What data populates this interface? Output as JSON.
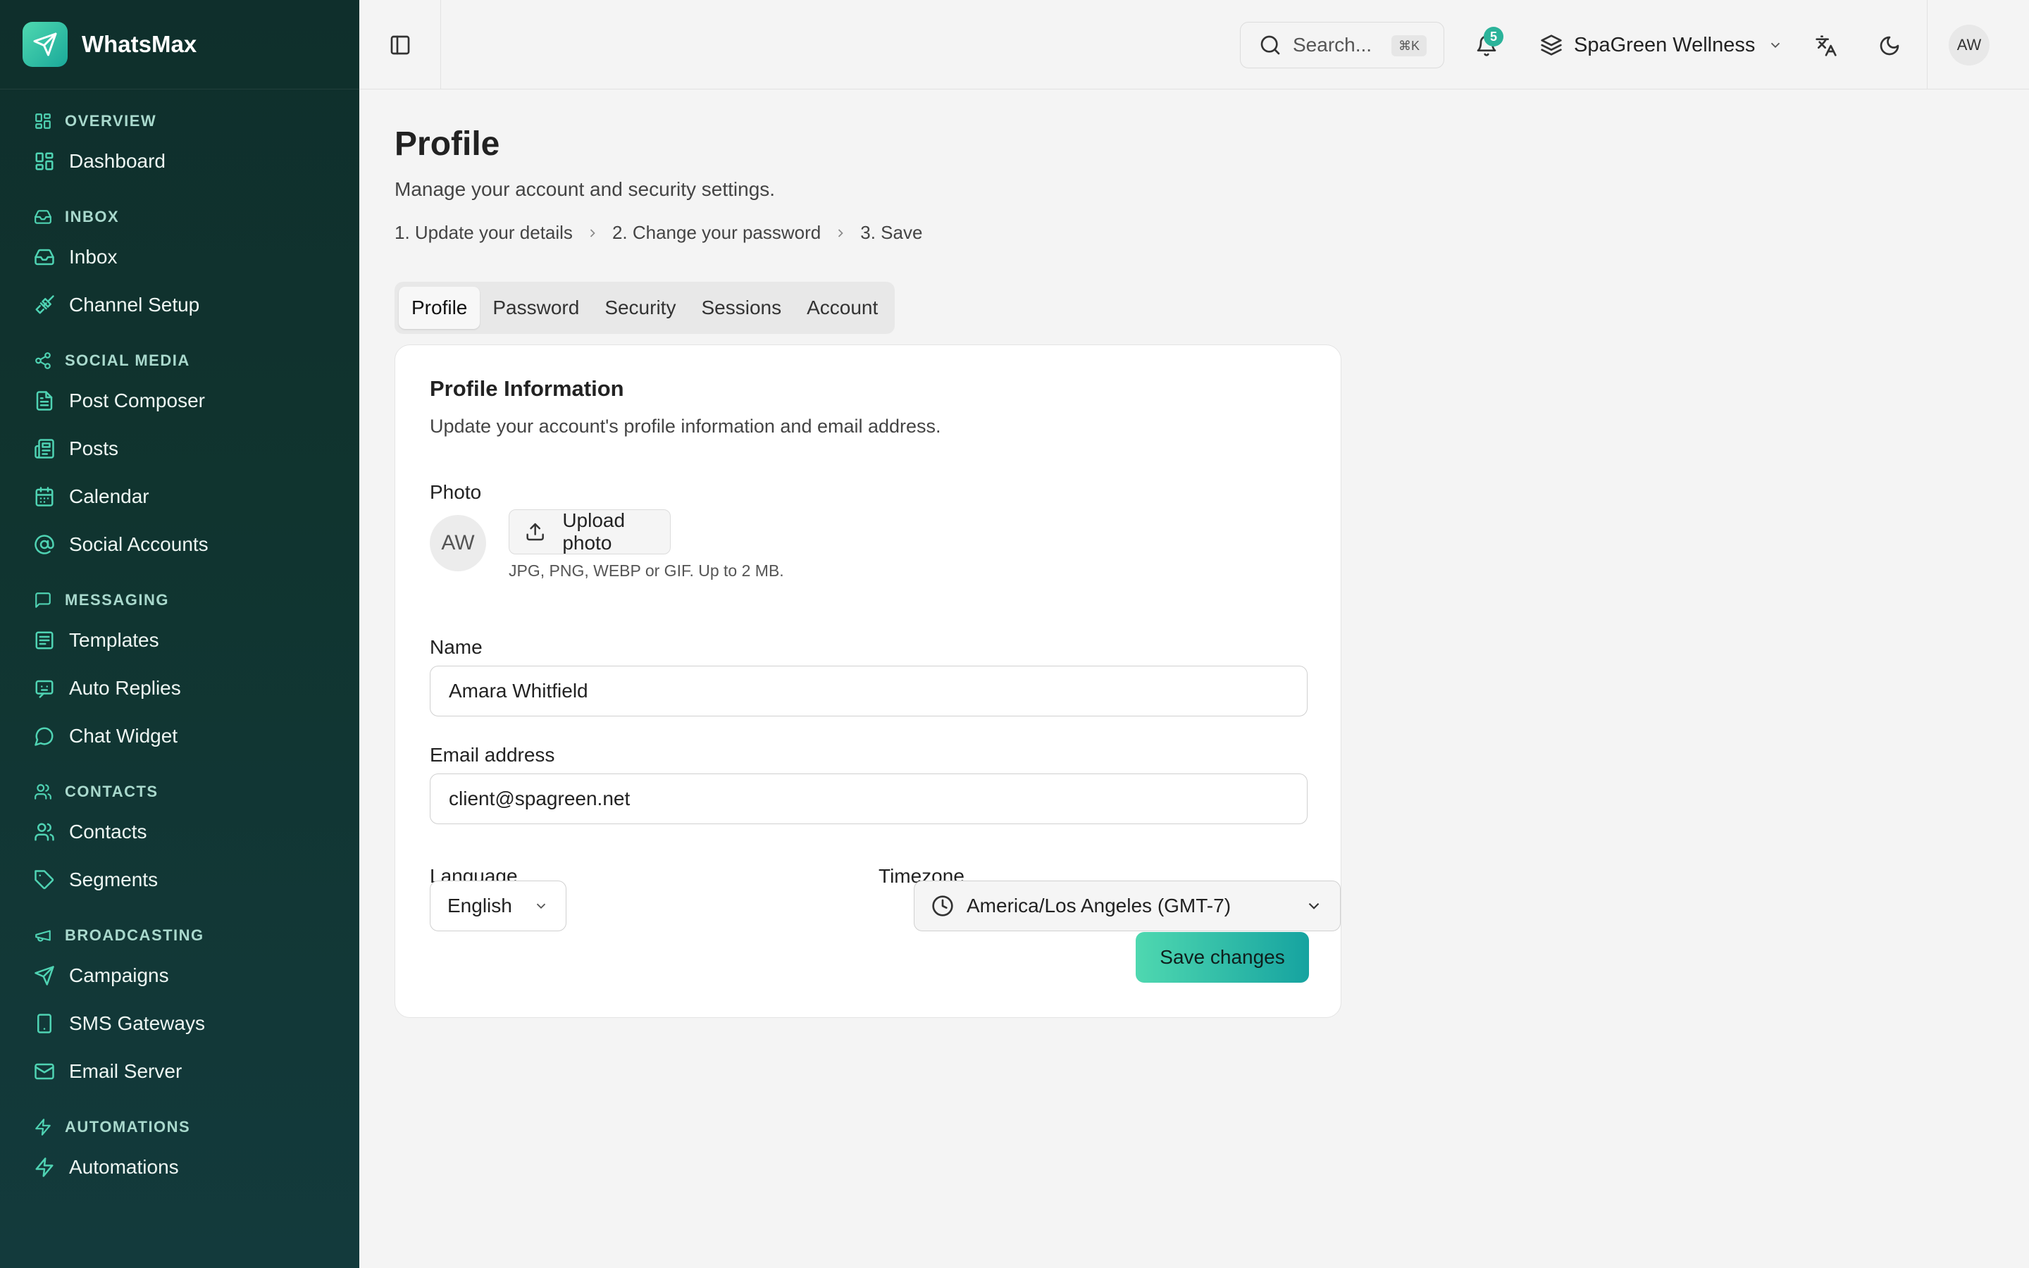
{
  "brand": {
    "name": "WhatsMax"
  },
  "nav": [
    {
      "heading": "OVERVIEW",
      "heading_icon": "grid-icon",
      "items": [
        {
          "label": "Dashboard",
          "icon": "grid-icon"
        }
      ]
    },
    {
      "heading": "INBOX",
      "heading_icon": "inbox-icon",
      "items": [
        {
          "label": "Inbox",
          "icon": "inbox-icon"
        },
        {
          "label": "Channel Setup",
          "icon": "plug-icon"
        }
      ]
    },
    {
      "heading": "SOCIAL MEDIA",
      "heading_icon": "share-icon",
      "items": [
        {
          "label": "Post Composer",
          "icon": "file-text-icon"
        },
        {
          "label": "Posts",
          "icon": "newspaper-icon"
        },
        {
          "label": "Calendar",
          "icon": "calendar-icon"
        },
        {
          "label": "Social Accounts",
          "icon": "at-sign-icon"
        }
      ]
    },
    {
      "heading": "MESSAGING",
      "heading_icon": "message-square-icon",
      "items": [
        {
          "label": "Templates",
          "icon": "template-icon"
        },
        {
          "label": "Auto Replies",
          "icon": "bot-message-icon"
        },
        {
          "label": "Chat Widget",
          "icon": "message-circle-icon"
        }
      ]
    },
    {
      "heading": "CONTACTS",
      "heading_icon": "users-icon",
      "items": [
        {
          "label": "Contacts",
          "icon": "users-icon"
        },
        {
          "label": "Segments",
          "icon": "tag-icon"
        }
      ]
    },
    {
      "heading": "BROADCASTING",
      "heading_icon": "megaphone-icon",
      "items": [
        {
          "label": "Campaigns",
          "icon": "send-icon"
        },
        {
          "label": "SMS Gateways",
          "icon": "smartphone-icon"
        },
        {
          "label": "Email Server",
          "icon": "mail-icon"
        }
      ]
    },
    {
      "heading": "AUTOMATIONS",
      "heading_icon": "zap-icon",
      "items": [
        {
          "label": "Automations",
          "icon": "zap-icon"
        }
      ]
    }
  ],
  "topbar": {
    "search_placeholder": "Search...",
    "search_shortcut": "⌘K",
    "notifications_count": "5",
    "workspace": "SpaGreen Wellness",
    "user_initials": "AW"
  },
  "page": {
    "title": "Profile",
    "subtitle": "Manage your account and security settings.",
    "steps": [
      "1. Update your details",
      "2. Change your password",
      "3. Save"
    ]
  },
  "tabs": [
    {
      "label": "Profile",
      "active": true
    },
    {
      "label": "Password",
      "active": false
    },
    {
      "label": "Security",
      "active": false
    },
    {
      "label": "Sessions",
      "active": false
    },
    {
      "label": "Account",
      "active": false
    }
  ],
  "profile_card": {
    "title": "Profile Information",
    "description": "Update your account's profile information and email address.",
    "photo_label": "Photo",
    "avatar_initials": "AW",
    "upload_label": "Upload photo",
    "upload_hint": "JPG, PNG, WEBP or GIF. Up to 2 MB.",
    "name_label": "Name",
    "name_value": "Amara Whitfield",
    "email_label": "Email address",
    "email_value": "client@spagreen.net",
    "language_label": "Language",
    "language_value": "English",
    "timezone_label": "Timezone",
    "timezone_value": "America/Los Angeles (GMT-7)",
    "save_label": "Save changes"
  },
  "colors": {
    "sidebar_bg": "#10342f",
    "accent": "#2bb39a",
    "icon_accent": "#4fd3b3"
  }
}
